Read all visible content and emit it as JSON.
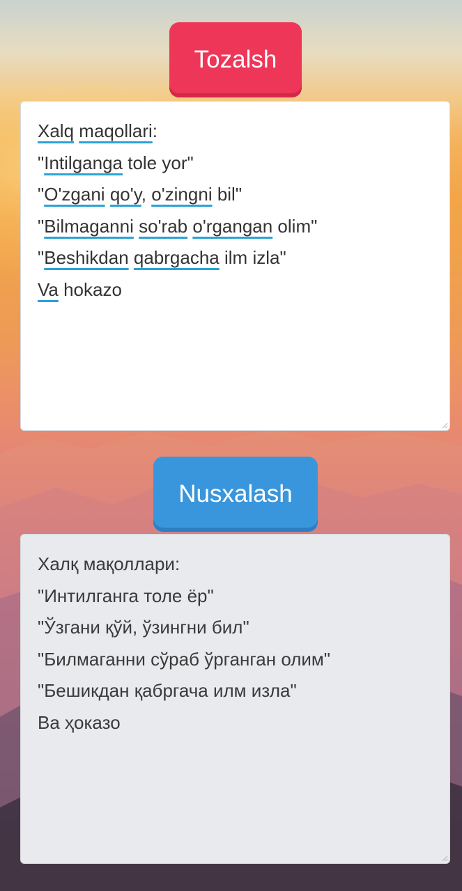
{
  "clear_button": {
    "label": "Tozalsh"
  },
  "copy_button": {
    "label": "Nusxalash"
  },
  "input_panel": {
    "lines": [
      {
        "segments": [
          {
            "t": "Xalq",
            "s": true
          },
          {
            "t": " ",
            "s": false
          },
          {
            "t": "maqollari",
            "s": true
          },
          {
            "t": ":",
            "s": false
          }
        ]
      },
      {
        "segments": [
          {
            "t": "\"",
            "s": false
          },
          {
            "t": "Intilganga",
            "s": true
          },
          {
            "t": " tole yor\"",
            "s": false
          }
        ]
      },
      {
        "segments": [
          {
            "t": "\"",
            "s": false
          },
          {
            "t": "O'zgani",
            "s": true
          },
          {
            "t": " ",
            "s": false
          },
          {
            "t": "qo'y",
            "s": true
          },
          {
            "t": ", ",
            "s": false
          },
          {
            "t": "o'zingni",
            "s": true
          },
          {
            "t": " bil\"",
            "s": false
          }
        ]
      },
      {
        "segments": [
          {
            "t": "\"",
            "s": false
          },
          {
            "t": "Bilmaganni",
            "s": true
          },
          {
            "t": " ",
            "s": false
          },
          {
            "t": "so'rab",
            "s": true
          },
          {
            "t": " ",
            "s": false
          },
          {
            "t": "o'rgangan",
            "s": true
          },
          {
            "t": " olim\"",
            "s": false
          }
        ]
      },
      {
        "segments": [
          {
            "t": "\"",
            "s": false
          },
          {
            "t": "Beshikdan",
            "s": true
          },
          {
            "t": " ",
            "s": false
          },
          {
            "t": "qabrgacha",
            "s": true
          },
          {
            "t": " ilm izla\"",
            "s": false
          }
        ]
      },
      {
        "segments": [
          {
            "t": "Va",
            "s": true
          },
          {
            "t": " hokazo",
            "s": false
          }
        ]
      }
    ]
  },
  "output_panel": {
    "lines": [
      "Халқ мақоллари:",
      "\"Интилганга толе ёр\"",
      "\"Ўзгани қўй, ўзингни бил\"",
      "\"Билмаганни сўраб ўрганган олим\"",
      "\"Бешикдан қабргача илм изла\"",
      "Ва ҳоказо"
    ]
  },
  "colors": {
    "clear_button": "#ee3658",
    "copy_button": "#3a96dc",
    "spellcheck_underline": "#29a3d6"
  }
}
